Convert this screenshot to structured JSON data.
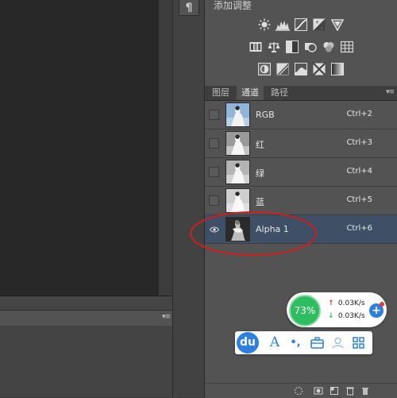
{
  "dock": {
    "paragraph_glyph": "¶"
  },
  "adjustments": {
    "title": "添加调整"
  },
  "tabs": [
    {
      "label": "图层",
      "active": false
    },
    {
      "label": "通道",
      "active": true
    },
    {
      "label": "路径",
      "active": false
    }
  ],
  "menu_glyph": "▾≡",
  "channels": [
    {
      "name": "RGB",
      "shortcut": "Ctrl+2",
      "visible": false,
      "selected": false
    },
    {
      "name": "红",
      "shortcut": "Ctrl+3",
      "visible": false,
      "selected": false
    },
    {
      "name": "绿",
      "shortcut": "Ctrl+4",
      "visible": false,
      "selected": false
    },
    {
      "name": "蓝",
      "shortcut": "Ctrl+5",
      "visible": false,
      "selected": false
    },
    {
      "name": "Alpha 1",
      "shortcut": "Ctrl+6",
      "visible": true,
      "selected": true
    }
  ],
  "net_widget": {
    "percent": "73%",
    "upload": "0.03K/s",
    "download": "0.03K/s",
    "plus": "+"
  },
  "ime_bar": {
    "logo": "du",
    "font_glyph": "A",
    "punct_glyph": "•,"
  },
  "colors": {
    "panel": "#535353",
    "selected_row": "#3e4f66",
    "highlight_ellipse": "#cc1f1f",
    "net_green": "#2ebd5f",
    "ime_blue": "#2d7fe0"
  }
}
